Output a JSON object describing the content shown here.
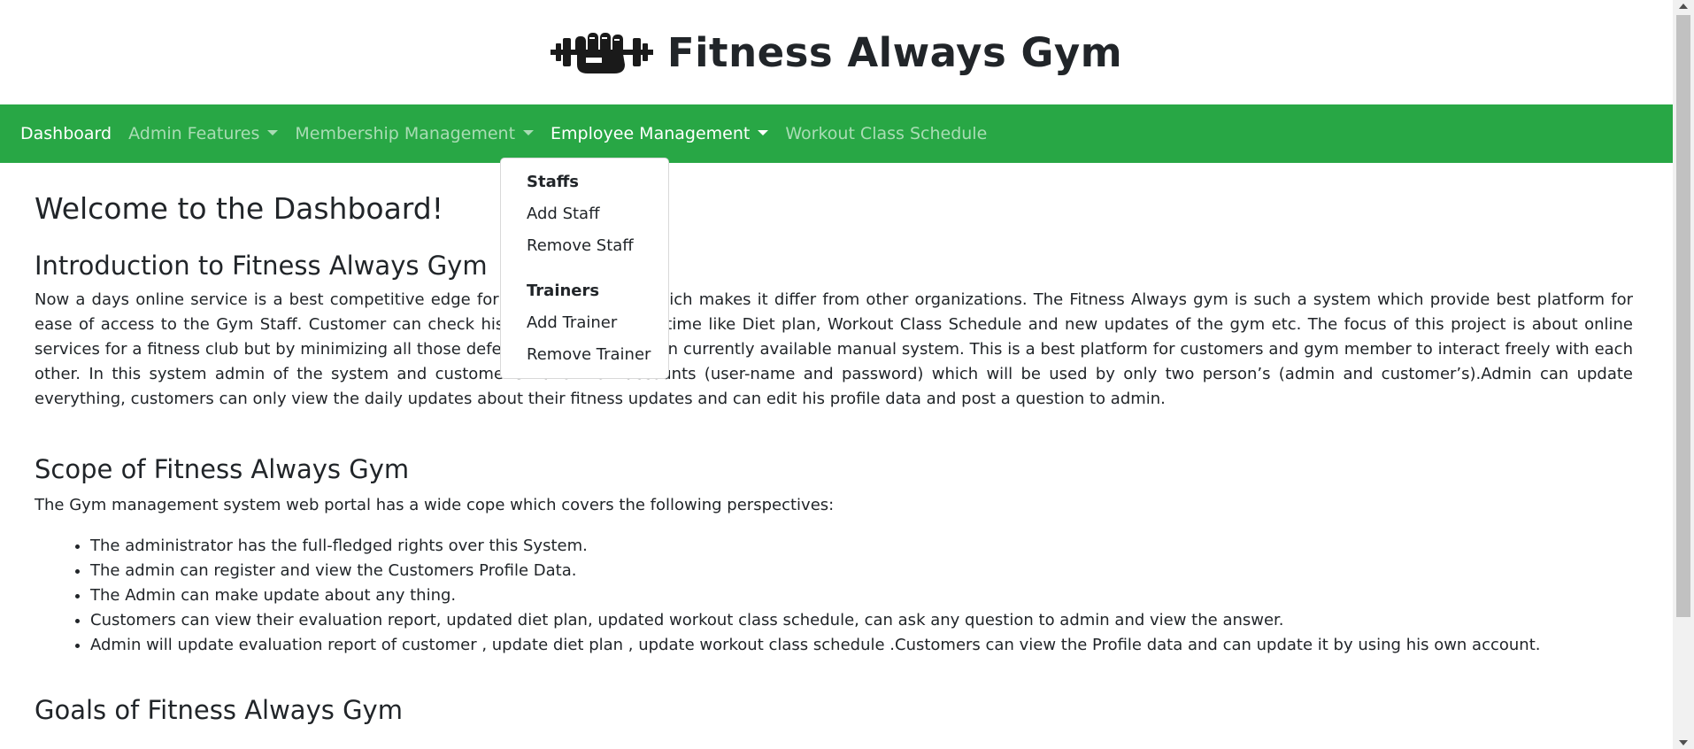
{
  "header": {
    "logo_icon": "fist-dumbbell-icon",
    "title": "Fitness Always Gym"
  },
  "nav": {
    "items": [
      {
        "label": "Dashboard",
        "active": true,
        "dropdown": false
      },
      {
        "label": "Admin Features",
        "active": false,
        "dropdown": true
      },
      {
        "label": "Membership Management",
        "active": false,
        "dropdown": true
      },
      {
        "label": "Employee Management",
        "active": false,
        "dropdown": true,
        "open": true
      },
      {
        "label": "Workout Class Schedule",
        "active": false,
        "dropdown": false
      }
    ],
    "color": "#28a745"
  },
  "dropdown": {
    "staff_header": "Staffs",
    "add_staff": "Add Staff",
    "remove_staff": "Remove Staff",
    "trainer_header": "Trainers",
    "add_trainer": "Add Trainer",
    "remove_trainer": "Remove Trainer"
  },
  "content": {
    "heading": "Welcome to the Dashboard!",
    "intro_title": "Introduction to Fitness Always Gym",
    "intro_text": "Now a days online service is a best competitive edge for any organization which makes it differ from other organizations. The Fitness Always gym is such a system which provide best platform for ease of access to the Gym Staff. Customer can check his updates online anytime like Diet plan, Workout Class Schedule and new updates of the gym etc. The focus of this project is about online services for a fitness club but by minimizing all those defects which are found in currently available manual system. This is a best platform for customers and gym member to interact freely with each other. In this system admin of the system and customer’s have their accounts (user-name and password) which will be used by only two person’s (admin and customer’s).Admin can update everything, customers can only view the daily updates about their fitness updates and can edit his profile data and post a question to admin.",
    "scope_title": "Scope of Fitness Always Gym",
    "scope_text": "The Gym management system web portal has a wide cope which covers the following perspectives:",
    "scope_items": [
      "The administrator has the full-fledged rights over this System.",
      "The admin can register and view the Customers Profile Data.",
      "The Admin can make update about any thing.",
      "Customers can view their evaluation report, updated diet plan, updated workout class schedule, can ask any question to admin and view the answer.",
      "Admin will update evaluation report of customer , update diet plan , update workout class schedule .Customers can view the Profile data and can update it by using his own account."
    ],
    "goals_title": "Goals of Fitness Always Gym"
  }
}
